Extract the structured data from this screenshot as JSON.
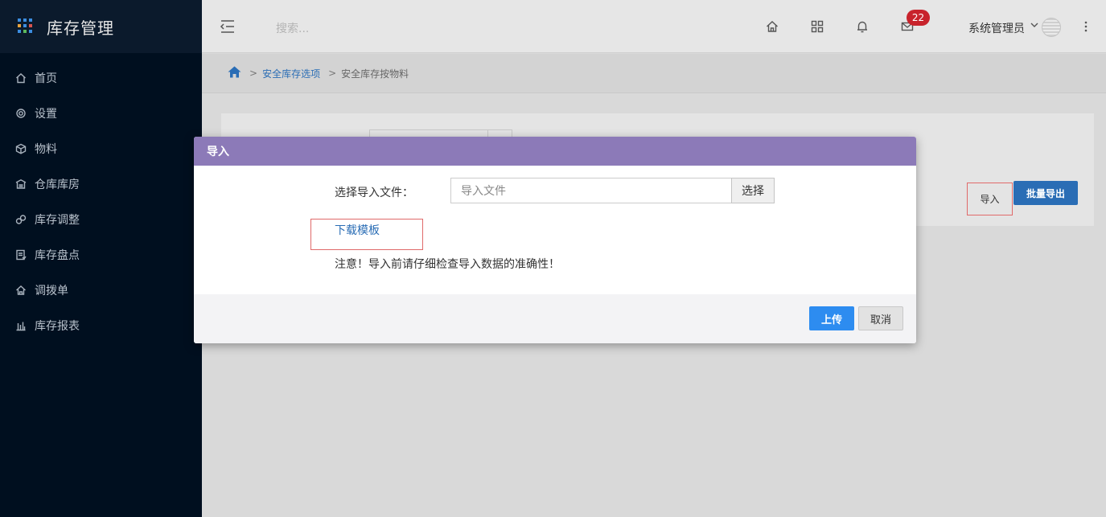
{
  "brand": {
    "title": "库存管理",
    "icon": "app-grid-icon",
    "dot_colors": [
      "#3b8de0",
      "#3b8de0",
      "#3b8de0",
      "#e8a33d",
      "#3b8de0",
      "#d9534f",
      "#3b8de0",
      "#5cb85c",
      "#3b8de0"
    ]
  },
  "sidebar": {
    "items": [
      {
        "label": "首页",
        "icon": "home-icon"
      },
      {
        "label": "设置",
        "icon": "gear-icon"
      },
      {
        "label": "物料",
        "icon": "cube-icon"
      },
      {
        "label": "仓库库房",
        "icon": "warehouse-icon"
      },
      {
        "label": "库存调整",
        "icon": "adjust-icon"
      },
      {
        "label": "库存盘点",
        "icon": "inventory-check-icon"
      },
      {
        "label": "调拨单",
        "icon": "transfer-icon"
      },
      {
        "label": "库存报表",
        "icon": "bar-chart-icon"
      }
    ]
  },
  "header": {
    "search_placeholder": "搜索...",
    "mail_badge": "22",
    "user_name": "系统管理员",
    "icons": [
      "menu-toggle-icon",
      "home-icon",
      "apps-icon",
      "bell-icon",
      "mail-icon",
      "chevron-down-icon",
      "more-vertical-icon"
    ]
  },
  "breadcrumb": {
    "sep1": ">",
    "link": "安全库存选项",
    "sep2": ">",
    "current": "安全库存按物料"
  },
  "page_actions": {
    "import_label": "导入",
    "export_label": "批量导出"
  },
  "modal": {
    "title": "导入",
    "file_label": "选择导入文件：",
    "file_placeholder": "导入文件",
    "choose_label": "选择",
    "download_template": "下载模板",
    "note": "注意！导入前请仔细检查导入数据的准确性！",
    "upload_label": "上传",
    "cancel_label": "取消"
  },
  "colors": {
    "sidebar_bg": "#000f1f",
    "modal_header": "#8c7ab8",
    "primary": "#2d8cf0",
    "link": "#2a6db5",
    "badge": "#c8232c",
    "highlight_box": "#e06a6a"
  }
}
